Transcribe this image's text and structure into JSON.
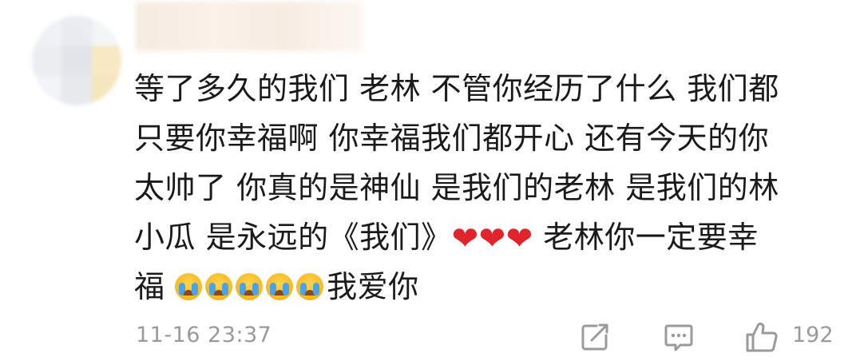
{
  "comment": {
    "lines": [
      "等了多久的我们 老林 不管你经历了什么 我们都",
      "只要你幸福啊 你幸福我们都开心 还有今天的你",
      "太帅了 你真的是神仙 是我们的老林 是我们的林",
      "老林你一定要幸",
      "我爱你"
    ],
    "line4_prefix": "小瓜 是永远的《我们》",
    "line5_prefix": "福 ",
    "hearts": [
      "❤",
      "❤",
      "❤"
    ],
    "cry_emoji_count": 5
  },
  "footer": {
    "timestamp": "11-16 23:37",
    "like_count": "192",
    "icons": [
      "share-icon",
      "comment-icon",
      "like-icon"
    ]
  },
  "colors": {
    "text": "#1a1a1a",
    "meta": "#9a9a9a",
    "heart": "#e0242b"
  }
}
